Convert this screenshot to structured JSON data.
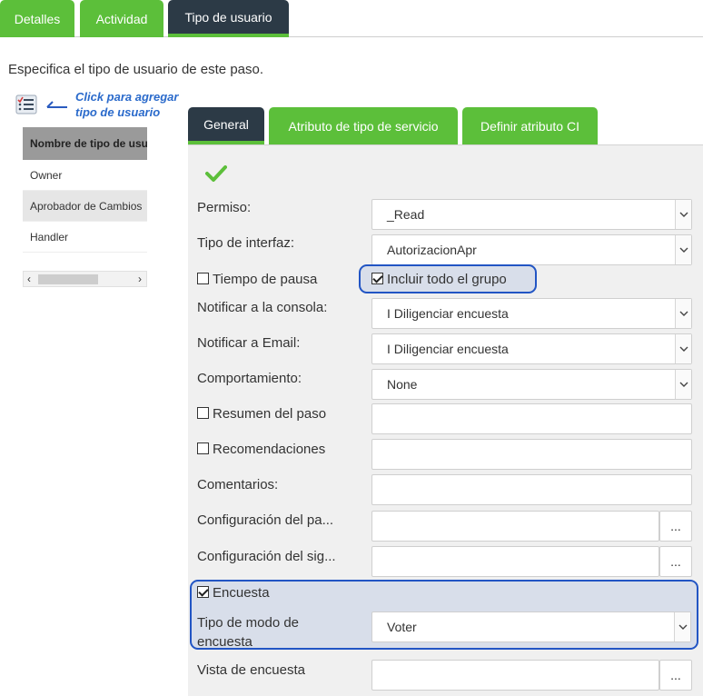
{
  "top_tabs": [
    {
      "label": "Detalles"
    },
    {
      "label": "Actividad"
    },
    {
      "label": "Tipo de usuario"
    }
  ],
  "intro_text": "Especifica el tipo de usuario de este paso.",
  "add_hint": {
    "line1": "Click para agregar",
    "line2": "tipo de usuario"
  },
  "user_types": {
    "header": "Nombre de tipo de usuario",
    "rows": [
      "Owner",
      "Aprobador de Cambios",
      "Handler"
    ]
  },
  "inner_tabs": [
    {
      "label": "General"
    },
    {
      "label": "Atributo de tipo de servicio"
    },
    {
      "label": "Definir atributo CI"
    }
  ],
  "form": {
    "permiso": {
      "label": "Permiso:",
      "value": "_Read"
    },
    "tipo_interfaz": {
      "label": "Tipo de interfaz:",
      "value": "AutorizacionApr"
    },
    "tiempo_pausa": {
      "label": "Tiempo de pausa",
      "checked": false
    },
    "incluir_grupo": {
      "label": "Incluir todo el grupo",
      "checked": true
    },
    "notificar_consola": {
      "label": "Notificar a la consola:",
      "value": "I Diligenciar encuesta"
    },
    "notificar_email": {
      "label": "Notificar a Email:",
      "value": "I Diligenciar encuesta"
    },
    "comportamiento": {
      "label": "Comportamiento:",
      "value": "None"
    },
    "resumen_paso": {
      "label": "Resumen del paso",
      "checked": false,
      "value": ""
    },
    "recomendaciones": {
      "label": "Recomendaciones",
      "checked": false,
      "value": ""
    },
    "comentarios": {
      "label": "Comentarios:",
      "value": ""
    },
    "config_pa": {
      "label": "Configuración del pa...",
      "value": "",
      "button": "..."
    },
    "config_sig": {
      "label": "Configuración del sig...",
      "value": "",
      "button": "..."
    },
    "encuesta": {
      "label": "Encuesta",
      "checked": true
    },
    "tipo_modo": {
      "label_line1": "Tipo de modo de",
      "label_line2": "encuesta",
      "value": "Voter"
    },
    "vista_encuesta": {
      "label": "Vista de encuesta",
      "value": "",
      "button": "..."
    }
  },
  "colors": {
    "tab_green": "#5cbf3a",
    "tab_dark": "#2c3a46",
    "highlight_border": "#2255c4",
    "link_blue": "#2a6acb"
  }
}
